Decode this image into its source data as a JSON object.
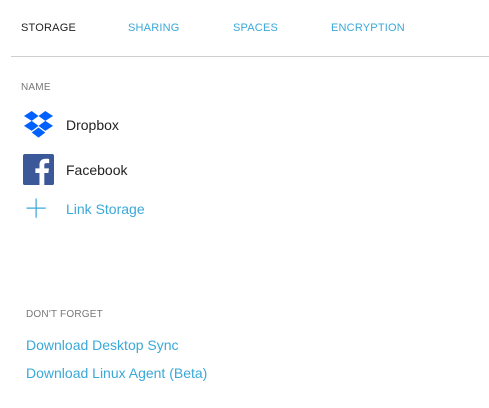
{
  "tabs": [
    {
      "label": "STORAGE",
      "active": true
    },
    {
      "label": "SHARING",
      "active": false
    },
    {
      "label": "SPACES",
      "active": false
    },
    {
      "label": "ENCRYPTION",
      "active": false
    }
  ],
  "storage": {
    "section_label": "NAME",
    "items": [
      {
        "label": "Dropbox",
        "icon": "dropbox-icon",
        "color": "#0061fe"
      },
      {
        "label": "Facebook",
        "icon": "facebook-icon",
        "color": "#3b5998"
      }
    ],
    "link_storage": {
      "label": "Link Storage",
      "icon": "plus-icon"
    }
  },
  "dont_forget": {
    "section_label": "DON'T FORGET",
    "links": [
      {
        "label": "Download Desktop Sync"
      },
      {
        "label": "Download Linux Agent (Beta)"
      }
    ]
  },
  "colors": {
    "accent": "#3aa8d8",
    "text": "#222222",
    "muted": "#777777",
    "divider": "#cfcfcf"
  }
}
